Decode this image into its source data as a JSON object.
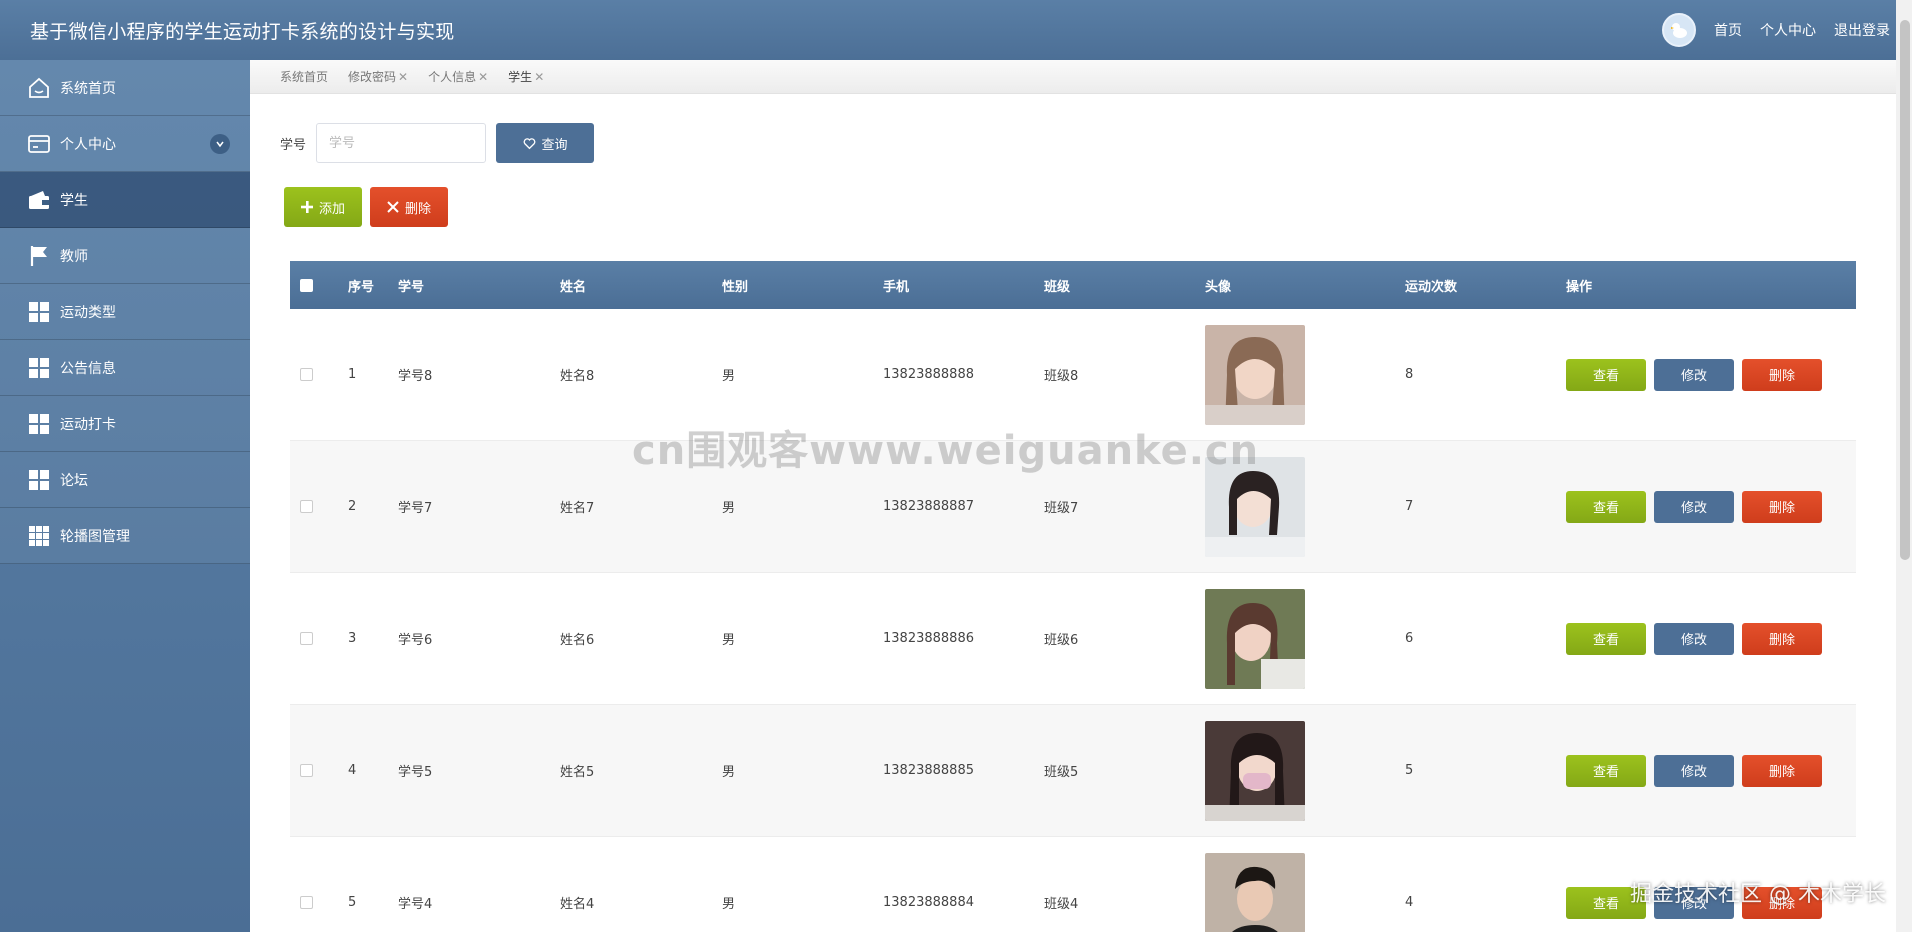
{
  "header": {
    "title": "基于微信小程序的学生运动打卡系统的设计与实现",
    "links": [
      "首页",
      "个人中心",
      "退出登录"
    ]
  },
  "sidebar": {
    "items": [
      {
        "label": "系统首页",
        "icon": "home-icon"
      },
      {
        "label": "个人中心",
        "icon": "card-icon"
      },
      {
        "label": "学生",
        "icon": "wallet-icon"
      },
      {
        "label": "教师",
        "icon": "flag-icon"
      },
      {
        "label": "运动类型",
        "icon": "grid-icon"
      },
      {
        "label": "公告信息",
        "icon": "grid-icon"
      },
      {
        "label": "运动打卡",
        "icon": "grid-icon"
      },
      {
        "label": "论坛",
        "icon": "grid-icon"
      },
      {
        "label": "轮播图管理",
        "icon": "grid9-icon"
      }
    ]
  },
  "tabs": [
    {
      "label": "系统首页",
      "closable": false
    },
    {
      "label": "修改密码",
      "closable": true
    },
    {
      "label": "个人信息",
      "closable": true
    },
    {
      "label": "学生",
      "closable": true
    }
  ],
  "search": {
    "label": "学号",
    "placeholder": "学号",
    "button": "查询"
  },
  "actions": {
    "add": "添加",
    "delete": "删除"
  },
  "table": {
    "headers": [
      "序号",
      "学号",
      "姓名",
      "性别",
      "手机",
      "班级",
      "头像",
      "运动次数",
      "操作"
    ],
    "ops": {
      "view": "查看",
      "edit": "修改",
      "delete": "删除"
    },
    "rows": [
      {
        "idx": "1",
        "sid": "学号8",
        "name": "姓名8",
        "sex": "男",
        "phone": "13823888888",
        "cls": "班级8",
        "count": "8"
      },
      {
        "idx": "2",
        "sid": "学号7",
        "name": "姓名7",
        "sex": "男",
        "phone": "13823888887",
        "cls": "班级7",
        "count": "7"
      },
      {
        "idx": "3",
        "sid": "学号6",
        "name": "姓名6",
        "sex": "男",
        "phone": "13823888886",
        "cls": "班级6",
        "count": "6"
      },
      {
        "idx": "4",
        "sid": "学号5",
        "name": "姓名5",
        "sex": "男",
        "phone": "13823888885",
        "cls": "班级5",
        "count": "5"
      },
      {
        "idx": "5",
        "sid": "学号4",
        "name": "姓名4",
        "sex": "男",
        "phone": "13823888884",
        "cls": "班级4",
        "count": "4"
      }
    ]
  },
  "watermarks": {
    "center": "cn围观客www.weiguanke.cn",
    "corner": "掘金技术社区 @ 木木学长"
  },
  "colors": {
    "primary": "#4d6f96",
    "success": "#8fb319",
    "danger": "#d94422"
  }
}
